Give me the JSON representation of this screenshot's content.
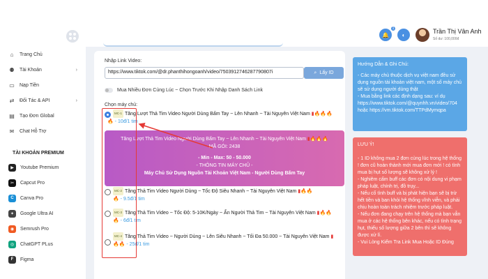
{
  "sidebar": {
    "items": [
      {
        "label": "Trang Chủ",
        "icon": "home-icon"
      },
      {
        "label": "Tài Khoản",
        "icon": "user-icon"
      },
      {
        "label": "Nạp Tiền",
        "icon": "card-icon"
      },
      {
        "label": "Đối Tác & API",
        "icon": "api-icon"
      },
      {
        "label": "Tạo Đơn Global",
        "icon": "store-icon"
      },
      {
        "label": "Chat Hỗ Trợ",
        "icon": "chat-icon"
      }
    ],
    "premium_title": "TÀI KHOẢN PREMIUM",
    "premium": [
      {
        "label": "Youtube Premium",
        "color": "#222222",
        "glyph": "▶"
      },
      {
        "label": "Capcut Pro",
        "color": "#111111",
        "glyph": "✂"
      },
      {
        "label": "Canva Pro",
        "color": "#1a8fd6",
        "glyph": "C"
      },
      {
        "label": "Google Ultra AI",
        "color": "#444444",
        "glyph": "✦"
      },
      {
        "label": "Semrush Pro",
        "color": "#f05a22",
        "glyph": "◉"
      },
      {
        "label": "ChatGPT PLus",
        "color": "#10a37f",
        "glyph": "◎"
      },
      {
        "label": "Figma",
        "color": "#333333",
        "glyph": "F"
      }
    ]
  },
  "header": {
    "notif_count": "1",
    "user_name": "Trần Thị Vân Anh",
    "balance": "Số dư: 100,000đ"
  },
  "form": {
    "link_label": "Nhập Link Video:",
    "link_value": "https://www.tiktok.com/@dr.phanthihongoanh/video/7503912746287790807i",
    "fetch_button": "Lấy ID",
    "multi_label": "Mua Nhiều Đơn Cùng Lúc ~ Chọn Trước Khi Nhập Danh Sách Link",
    "server_label": "Chọn máy chủ:"
  },
  "services": [
    {
      "code": "MC-1",
      "title": "Tăng Lượt Thả Tim Video Người Dùng Bấm Tay ~ Lên Nhanh ~ Tài Nguyên Việt Nam",
      "price": "10đ/1 tim",
      "selected": true
    },
    {
      "code": "MC-2",
      "title": "Tăng Thả Tim Video Người Dùng ~ Tốc Độ Siêu Nhanh ~ Tài Nguyên Việt Nam",
      "price": "9.5đ/1 tim",
      "selected": false
    },
    {
      "code": "MC-3",
      "title": "Tăng Thả Tim Video ~ Tốc Độ: 5-10K/Ngày ~ Ẩn Người Thả Tim ~ Tài Nguyên Việt Nam",
      "price": "6đ/1 tim",
      "selected": false
    },
    {
      "code": "MC-4",
      "title": "Tăng Thả Tim Video ~ Người Dùng ~ Lên Siêu Nhanh ~ Tối Đa 50.000 ~ Tài Nguyên Việt Nam",
      "price": "25đ/1 tim",
      "selected": false
    }
  ],
  "detail": {
    "title": "Tăng Lượt Thả Tim Video Người Dùng Bấm Tay ~ Lên Nhanh ~ Tài Nguyên Việt Nam",
    "package": "MÃ GÓI: 2438",
    "minmax": "- Min - Max: 50 - 50.000",
    "server_info": "- THÔNG TIN MÁY CHỦ -",
    "server_desc": "Máy Chủ Sử Dụng Nguồn Tài Khoản Việt Nam - Người Dùng Bấm Tay"
  },
  "guide": {
    "title": "Hướng Dẫn & Ghi Chú:",
    "lines": [
      "- Các máy chủ thuộc dịch vụ việt nam đều sử dụng nguồn tài khoản việt nam, một số máy chủ sẽ sử dụng người dùng thật",
      "- Mua bằng link các định dạng sau: ví dụ",
      "https://www.tiktok.com/@quynhh.vn/video/704",
      "hoặc https://vm.tiktok.com/TTPdMymqpa"
    ]
  },
  "notes": {
    "title": "LƯU Ý!",
    "lines": [
      "- 1 ID không mua 2 đơn cùng lúc trong hệ thống ! đơn cũ hoàn thành mới mua đơn mới ! có tình mua bị hụt số lượng sẽ không xử lý !",
      "- Nghiêm cấm buff các đơn có nội dung vi phạm pháp luật, chính trị, đồ trụy...",
      "- Nếu cố tình buff và bị phát hiện bạn sẽ bị trừ hết tiền và ban khỏi hệ thống vĩnh viễn, và phải chịu hoàn toàn trách nhiệm trước pháp luật.",
      "- Nếu đơn đang chạy trên hệ thống mà bạn vẫn mua ở các hệ thống bên khác, nếu có tình trạng hụt, thiếu số lượng giữa 2 bên thì sẽ không được xử lí.",
      "- Vui Lòng Kiểm Tra Link Mua Hoặc ID Đúng"
    ]
  }
}
